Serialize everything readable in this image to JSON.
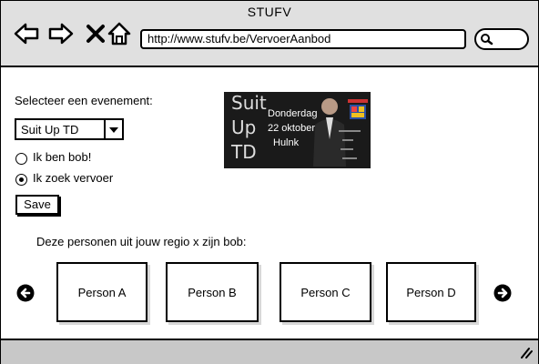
{
  "window": {
    "title": "STUFV"
  },
  "browser": {
    "url": "http://www.stufv.be/VervoerAanbod",
    "icons": [
      "back-arrow-icon",
      "forward-arrow-icon",
      "close-icon",
      "home-icon",
      "search-icon"
    ]
  },
  "form": {
    "event_label": "Selecteer een evenement:",
    "event_selected": "Suit Up TD",
    "radio_options": [
      {
        "label": "Ik ben bob!",
        "checked": false
      },
      {
        "label": "Ik zoek vervoer",
        "checked": true
      }
    ],
    "save_label": "Save"
  },
  "banner": {
    "title_lines": [
      "Suit",
      "Up",
      "TD"
    ],
    "date_lines": [
      "Donderdag",
      "22 oktober",
      "Hulnk"
    ]
  },
  "bob_section": {
    "heading": "Deze personen uit jouw regio x zijn bob:",
    "persons": [
      "Person A",
      "Person B",
      "Person C",
      "Person D"
    ]
  }
}
